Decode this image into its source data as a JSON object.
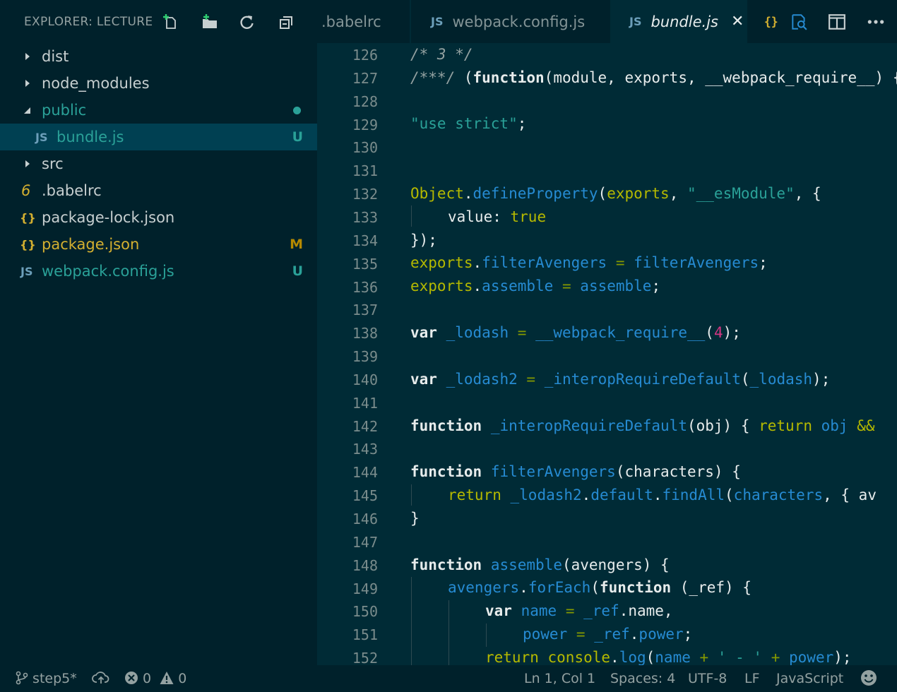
{
  "sidebar": {
    "title": "EXPLORER: LECTURE",
    "actions": [
      "new-file-icon",
      "new-folder-icon",
      "refresh-icon",
      "collapse-all-icon"
    ],
    "items": [
      {
        "label": "dist",
        "type": "folder",
        "expanded": false,
        "badge": "",
        "color": "#c7cfd0"
      },
      {
        "label": "node_modules",
        "type": "folder",
        "expanded": false,
        "badge": "",
        "color": "#c7cfd0"
      },
      {
        "label": "public",
        "type": "folder",
        "expanded": true,
        "badge": "",
        "color": "#2aa198",
        "modified_dot": true
      },
      {
        "label": "bundle.js",
        "type": "js",
        "badge": "U",
        "color": "#2aa198",
        "selected": true
      },
      {
        "label": "src",
        "type": "folder",
        "expanded": false,
        "badge": "",
        "color": "#c7cfd0"
      },
      {
        "label": ".babelrc",
        "type": "babel",
        "badge": "",
        "color": "#c7cfd0"
      },
      {
        "label": "package-lock.json",
        "type": "json",
        "badge": "",
        "color": "#c7cfd0"
      },
      {
        "label": "package.json",
        "type": "json",
        "badge": "M",
        "color": "#b58900"
      },
      {
        "label": "webpack.config.js",
        "type": "js",
        "badge": "U",
        "color": "#2aa198"
      }
    ],
    "icon_glyphs": {
      "js": "JS",
      "json": "{}",
      "babel": "6"
    }
  },
  "tabs": [
    {
      "label": ".babelrc",
      "icon": "",
      "active": false
    },
    {
      "label": "webpack.config.js",
      "icon": "JS",
      "active": false
    },
    {
      "label": "bundle.js",
      "icon": "JS",
      "active": true,
      "close": "✕"
    }
  ],
  "toolbar": {
    "actions": [
      "json-braces-icon",
      "open-preview-icon",
      "split-editor-icon",
      "more-actions-icon"
    ]
  },
  "editor": {
    "line_numbers": [
      "126",
      "127",
      "128",
      "129",
      "130",
      "131",
      "132",
      "133",
      "134",
      "135",
      "136",
      "137",
      "138",
      "139",
      "140",
      "141",
      "142",
      "143",
      "144",
      "145",
      "146",
      "147",
      "148",
      "149",
      "150",
      "151",
      "152"
    ]
  },
  "status": {
    "branch": "step5*",
    "errors": "0",
    "warnings": "0",
    "position": "Ln 1, Col 1",
    "spaces": "Spaces: 4",
    "encoding": "UTF-8",
    "eol": "LF",
    "language": "JavaScript"
  },
  "colors": {
    "accent": "#2aa198",
    "modified": "#b58900",
    "background": "#002b36",
    "sidebar": "#00212b",
    "selection": "#004052"
  }
}
